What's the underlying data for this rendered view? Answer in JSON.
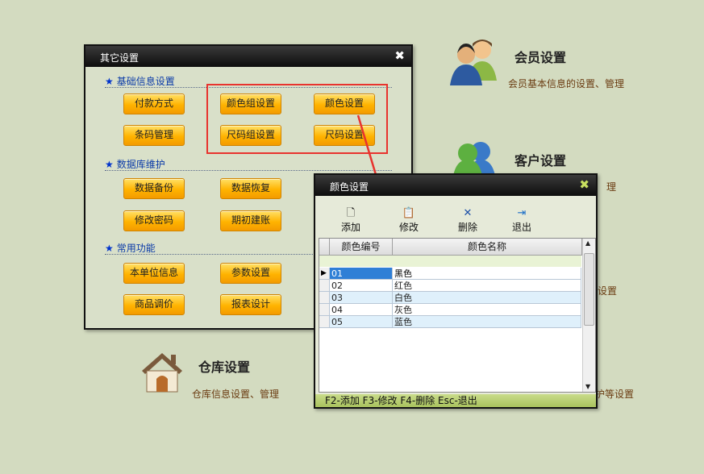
{
  "tiles": {
    "member": {
      "title": "会员设置",
      "desc": "会员基本信息的设置、管理"
    },
    "customer": {
      "title": "客户设置",
      "desc_partial": "理"
    },
    "mid_right_partial": "设置",
    "warehouse": {
      "title": "仓库设置",
      "desc": "仓库信息设置、管理"
    },
    "bottom_right_partial": "护等设置"
  },
  "dialog_other": {
    "title": "其它设置",
    "close": "✖",
    "sections": [
      {
        "label": "基础信息设置",
        "buttons": [
          "付款方式",
          "颜色组设置",
          "颜色设置",
          "条码管理",
          "尺码组设置",
          "尺码设置"
        ]
      },
      {
        "label": "数据库维护",
        "buttons": [
          "数据备份",
          "数据恢复",
          "修改密码",
          "期初建账"
        ]
      },
      {
        "label": "常用功能",
        "buttons": [
          "本单位信息",
          "参数设置",
          "商品调价",
          "报表设计"
        ]
      }
    ]
  },
  "dialog_color": {
    "title": "颜色设置",
    "close": "✖",
    "toolbar": [
      {
        "label": "添加",
        "icon": "add-document-icon"
      },
      {
        "label": "修改",
        "icon": "edit-clipboard-icon"
      },
      {
        "label": "删除",
        "icon": "delete-x-icon"
      },
      {
        "label": "退出",
        "icon": "exit-door-icon"
      }
    ],
    "columns": [
      "颜色编号",
      "颜色名称"
    ],
    "rows": [
      {
        "code": "01",
        "name": "黑色",
        "selected": true
      },
      {
        "code": "02",
        "name": "红色"
      },
      {
        "code": "03",
        "name": "白色"
      },
      {
        "code": "04",
        "name": "灰色"
      },
      {
        "code": "05",
        "name": "蓝色"
      }
    ],
    "status": "F2-添加 F3-修改 F4-删除 Esc-退出"
  },
  "colors": {
    "accent_red": "#e8332e",
    "button_orange": "#ffb300",
    "selected_row": "#2f7fd6",
    "alt_row": "#dff0fb"
  }
}
